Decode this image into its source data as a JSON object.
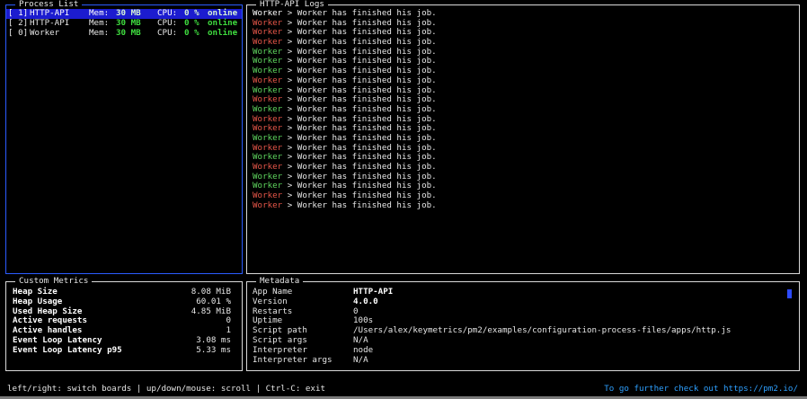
{
  "colors": {
    "accent_blue": "#2b5cff",
    "selected_row_bg": "#1c1ccf",
    "online_green": "#3fdc3f",
    "worker_green": "#5fd75f",
    "worker_red": "#e8574a",
    "footer_link": "#2ea0ff"
  },
  "process_list": {
    "title": "Process List",
    "rows": [
      {
        "id": "[ 1]",
        "name": "HTTP-API",
        "mem_label": "Mem:",
        "mem": "30 MB",
        "cpu_label": "CPU:",
        "cpu": "0 %",
        "status": "online",
        "selected": true
      },
      {
        "id": "[ 2]",
        "name": "HTTP-API",
        "mem_label": "Mem:",
        "mem": "30 MB",
        "cpu_label": "CPU:",
        "cpu": "0 %",
        "status": "online",
        "selected": false
      },
      {
        "id": "[ 0]",
        "name": "Worker",
        "mem_label": "Mem:",
        "mem": "30 MB",
        "cpu_label": "CPU:",
        "cpu": "0 %",
        "status": "online",
        "selected": false
      }
    ]
  },
  "logs": {
    "title": "HTTP-API Logs",
    "lines": [
      {
        "prefix": "Worker",
        "prefix_color": "white",
        "text": " > Worker has finished his job."
      },
      {
        "prefix": "Worker",
        "prefix_color": "red",
        "text": " > Worker has finished his job."
      },
      {
        "prefix": "Worker",
        "prefix_color": "red",
        "text": " > Worker has finished his job."
      },
      {
        "prefix": "Worker",
        "prefix_color": "red",
        "text": " > Worker has finished his job."
      },
      {
        "prefix": "Worker",
        "prefix_color": "green",
        "text": " > Worker has finished his job."
      },
      {
        "prefix": "Worker",
        "prefix_color": "green",
        "text": " > Worker has finished his job."
      },
      {
        "prefix": "Worker",
        "prefix_color": "green",
        "text": " > Worker has finished his job."
      },
      {
        "prefix": "Worker",
        "prefix_color": "red",
        "text": " > Worker has finished his job."
      },
      {
        "prefix": "Worker",
        "prefix_color": "green",
        "text": " > Worker has finished his job."
      },
      {
        "prefix": "Worker",
        "prefix_color": "red",
        "text": " > Worker has finished his job."
      },
      {
        "prefix": "Worker",
        "prefix_color": "green",
        "text": " > Worker has finished his job."
      },
      {
        "prefix": "Worker",
        "prefix_color": "red",
        "text": " > Worker has finished his job."
      },
      {
        "prefix": "Worker",
        "prefix_color": "red",
        "text": " > Worker has finished his job."
      },
      {
        "prefix": "Worker",
        "prefix_color": "green",
        "text": " > Worker has finished his job."
      },
      {
        "prefix": "Worker",
        "prefix_color": "red",
        "text": " > Worker has finished his job."
      },
      {
        "prefix": "Worker",
        "prefix_color": "green",
        "text": " > Worker has finished his job."
      },
      {
        "prefix": "Worker",
        "prefix_color": "red",
        "text": " > Worker has finished his job."
      },
      {
        "prefix": "Worker",
        "prefix_color": "green",
        "text": " > Worker has finished his job."
      },
      {
        "prefix": "Worker",
        "prefix_color": "green",
        "text": " > Worker has finished his job."
      },
      {
        "prefix": "Worker",
        "prefix_color": "red",
        "text": " > Worker has finished his job."
      },
      {
        "prefix": "Worker",
        "prefix_color": "red",
        "text": " > Worker has finished his job."
      }
    ]
  },
  "metrics": {
    "title": "Custom Metrics",
    "rows": [
      {
        "key": "Heap Size",
        "value": "8.08 MiB"
      },
      {
        "key": "Heap Usage",
        "value": "60.01 %"
      },
      {
        "key": "Used Heap Size",
        "value": "4.85 MiB"
      },
      {
        "key": "Active requests",
        "value": "0"
      },
      {
        "key": "Active handles",
        "value": "1"
      },
      {
        "key": "Event Loop Latency",
        "value": "3.08 ms"
      },
      {
        "key": "Event Loop Latency p95",
        "value": "5.33 ms"
      }
    ]
  },
  "metadata": {
    "title": "Metadata",
    "rows": [
      {
        "key": "App Name",
        "value": "HTTP-API",
        "bold": true
      },
      {
        "key": "Version",
        "value": "4.0.0",
        "bold": true
      },
      {
        "key": "Restarts",
        "value": "0",
        "bold": false
      },
      {
        "key": "Uptime",
        "value": "100s",
        "bold": false
      },
      {
        "key": "Script path",
        "value": "/Users/alex/keymetrics/pm2/examples/configuration-process-files/apps/http.js",
        "bold": false
      },
      {
        "key": "Script args",
        "value": "N/A",
        "bold": false
      },
      {
        "key": "Interpreter",
        "value": "node",
        "bold": false
      },
      {
        "key": "Interpreter args",
        "value": "N/A",
        "bold": false
      }
    ]
  },
  "footer": {
    "help": "left/right: switch boards | up/down/mouse: scroll | Ctrl-C: exit",
    "link": "To go further check out https://pm2.io/"
  }
}
